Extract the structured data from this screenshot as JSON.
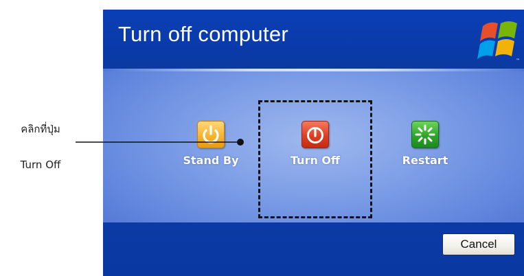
{
  "annotation": {
    "line1": "คลิกที่ปุ่ม",
    "line2": "Turn Off"
  },
  "dialog": {
    "title": "Turn off computer",
    "logo_icon": "windows-xp-flag-icon",
    "options": [
      {
        "id": "standby",
        "label": "Stand By",
        "icon": "standby-power-icon",
        "color": "#f6b530"
      },
      {
        "id": "turnoff",
        "label": "Turn Off",
        "icon": "power-icon",
        "color": "#df3f22"
      },
      {
        "id": "restart",
        "label": "Restart",
        "icon": "restart-icon",
        "color": "#2fa52a"
      }
    ],
    "cancel_label": "Cancel"
  },
  "colors": {
    "header_blue": "#0a3fb5",
    "body_blue": "#7b9ce6",
    "highlight": "#111111"
  }
}
